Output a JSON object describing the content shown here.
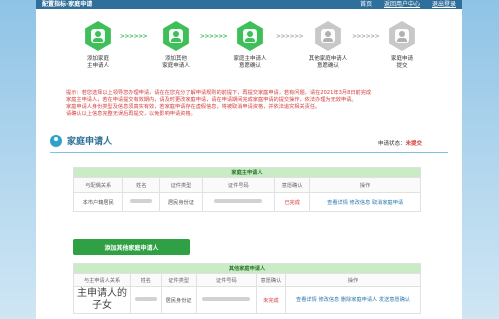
{
  "topbar": {
    "title": "配置指标·家庭申请",
    "link1": "首页",
    "link2": "返回用户中心",
    "link3": "退出登录"
  },
  "steps": [
    {
      "label_l1": "添加家庭",
      "label_l2": "主申请人",
      "state": "active"
    },
    {
      "label_l1": "添加其他",
      "label_l2": "家庭申请人",
      "state": "active"
    },
    {
      "label_l1": "家庭主申请人",
      "label_l2": "意愿确认",
      "state": "active"
    },
    {
      "label_l1": "其他家庭申请人",
      "label_l2": "意愿确认",
      "state": "inactive"
    },
    {
      "label_l1": "家庭申请",
      "label_l2": "提交",
      "state": "inactive"
    }
  ],
  "arrows": ">>>>>>",
  "notice": {
    "line1": "提示：若您选择以上领导您办理申请，请在在您充分了解申请规则的前提下，再提交家庭申请，若有问题，请在2021年3月8日前完成",
    "line2": "家庭主申请人，若在申请提交有效期内，请及时更改家庭申请，请在申请期间完成家庭申请的提交操作，依法办理为无效申请。",
    "line3": "家庭申请人身份类型及信息须真实有效，若家庭申请存在虚假信息，将被取消申请资格，并依法追究相关责任。",
    "line4": "请确认以上信息完整无误后再提交，以免影响申请资格。"
  },
  "status": {
    "label": "申请状态：",
    "value": "未提交"
  },
  "section": {
    "title": "家庭申请人"
  },
  "primary_table": {
    "caption": "家庭主申请人",
    "headers": [
      "与配偶关系",
      "姓名",
      "证件类型",
      "证件号码",
      "意愿确认",
      "操作"
    ],
    "row": {
      "relation": "本市户籍居民",
      "id_type": "居民身份证",
      "status": "已完成",
      "act1": "查看详情",
      "act2": "修改信息",
      "act3": "取消家庭申请"
    }
  },
  "add_button": {
    "label": "添加其他家庭申请人"
  },
  "other_table": {
    "caption": "其他家庭申请人",
    "headers": [
      "与主申请人关系",
      "姓名",
      "证件类型",
      "证件号码",
      "意愿确认",
      "操作"
    ],
    "row": {
      "relation": "主申请人的子女",
      "id_type": "居民身份证",
      "status": "未完成",
      "act1": "查看详情",
      "act2": "修改信息",
      "act3": "删除家庭申请人",
      "act4": "发送意愿确认"
    }
  },
  "colors": {
    "accent_green": "#3fbf5a",
    "header_blue": "#2f6f9b",
    "alert_red": "#d43c3c"
  }
}
